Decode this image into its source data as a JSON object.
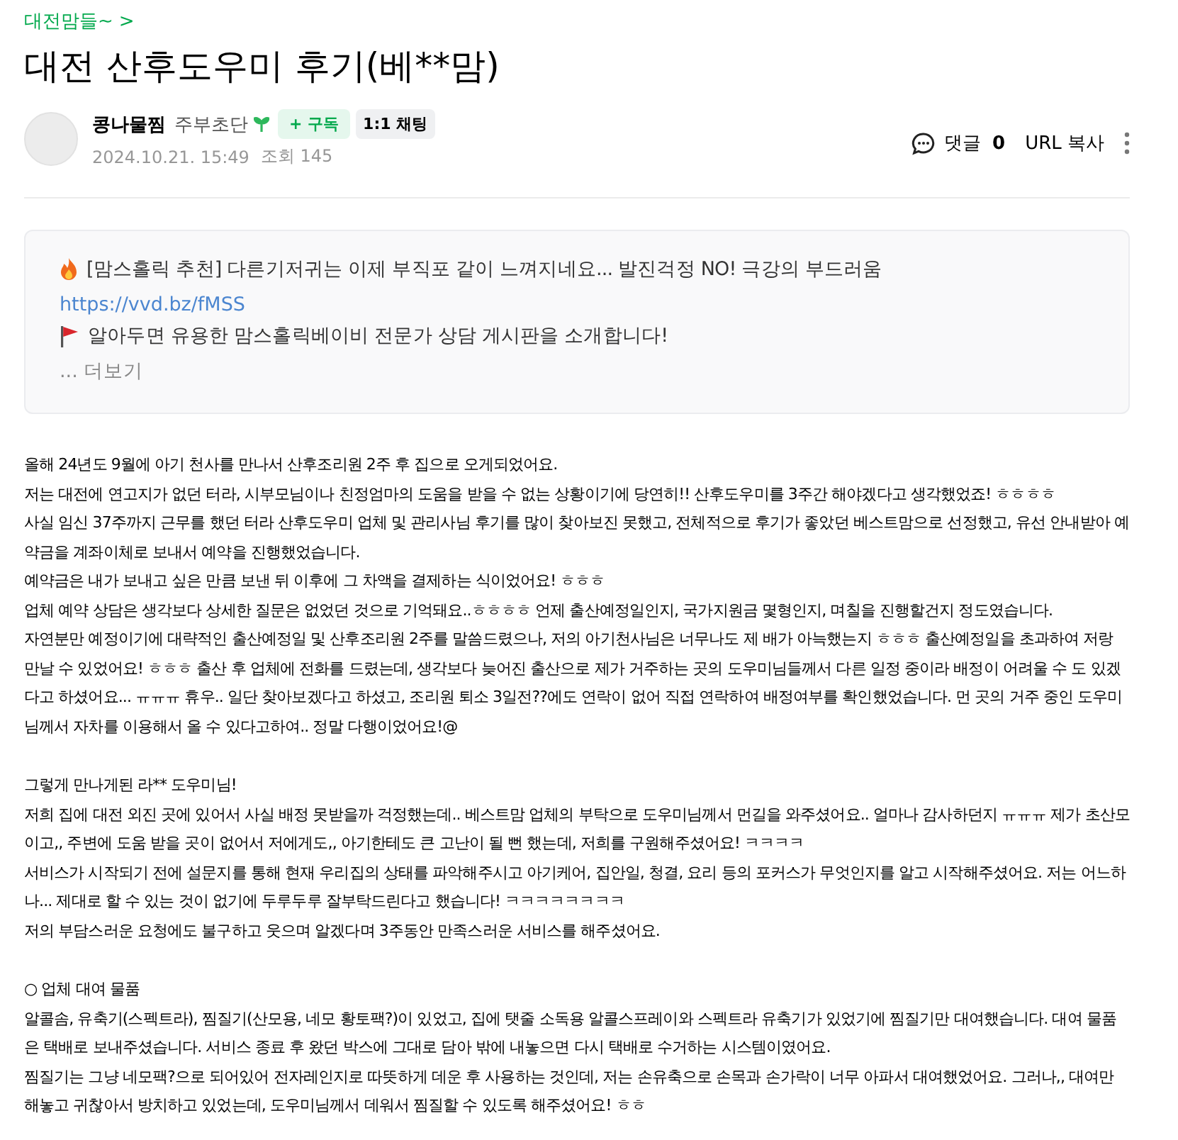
{
  "cafe_link": {
    "label": "대전맘들~",
    "arrow": ">"
  },
  "title": "대전 산후도우미 후기(베**맘)",
  "author": {
    "name": "콩나물찜",
    "grade": "주부초단",
    "subscribe": "+ 구독",
    "chat": "1:1 채팅",
    "date": "2024.10.21. 15:49",
    "views": "조회 145"
  },
  "actions": {
    "comments_label": "댓글",
    "comments_count": "0",
    "url_copy": "URL 복사"
  },
  "notice": {
    "lines": [
      {
        "kind": "fire",
        "text": "[맘스홀릭 추천] 다른기저귀는 이제 부직포 같이 느껴지네요... 발진걱정 NO! 극강의 부드러움"
      },
      {
        "kind": "link",
        "text": "https://vvd.bz/fMSS"
      },
      {
        "kind": "flag",
        "text": "알아두면 유용한 맘스홀릭베이비 전문가 상담 게시판을 소개합니다!"
      }
    ],
    "more": "... 더보기"
  },
  "body": {
    "sections": [
      {
        "paragraphs": [
          "올해 24년도 9월에 아기 천사를 만나서 산후조리원 2주 후 집으로 오게되었어요.",
          "저는 대전에 연고지가 없던 터라, 시부모님이나 친정엄마의 도움을 받을 수 없는 상황이기에 당연히!! 산후도우미를 3주간 해야겠다고 생각했었죠! ㅎㅎㅎㅎ",
          "사실 임신 37주까지 근무를 했던 터라 산후도우미 업체 및 관리사님 후기를 많이 찾아보진 못했고, 전체적으로 후기가 좋았던 베스트맘으로 선정했고, 유선 안내받아 예약금을 계좌이체로 보내서 예약을 진행했었습니다.",
          "예약금은 내가 보내고 싶은 만큼 보낸 뒤 이후에 그 차액을 결제하는 식이었어요! ㅎㅎㅎ",
          "업체 예약 상담은 생각보다 상세한 질문은 없었던 것으로 기억돼요..ㅎㅎㅎㅎ 언제 출산예정일인지, 국가지원금 몇형인지, 며칠을 진행할건지 정도였습니다.",
          "자연분만 예정이기에 대략적인 출산예정일 및 산후조리원 2주를 말씀드렸으나, 저의 아기천사님은 너무나도 제 배가 아늑했는지 ㅎㅎㅎ 출산예정일을 초과하여 저랑 만날 수 있었어요! ㅎㅎㅎ 출산 후 업체에 전화를 드렸는데, 생각보다 늦어진 출산으로 제가 거주하는 곳의 도우미님들께서 다른 일정 중이라 배정이 어려울 수 도 있겠다고 하셨어요... ㅠㅠㅠ 휴우.. 일단 찾아보겠다고 하셨고, 조리원 퇴소 3일전??에도 연락이 없어 직접 연락하여 배정여부를 확인했었습니다. 먼 곳의 거주 중인 도우미님께서 자차를 이용해서 올 수 있다고하여.. 정말 다행이었어요!@"
        ]
      },
      {
        "paragraphs": [
          "그렇게 만나게된 라** 도우미님!",
          "저희 집에 대전 외진 곳에 있어서 사실 배정 못받을까 걱정했는데.. 베스트맘 업체의 부탁으로 도우미님께서 먼길을 와주셨어요.. 얼마나 감사하던지 ㅠㅠㅠ 제가 초산모이고,, 주변에 도움 받을 곳이 없어서 저에게도,, 아기한테도 큰 고난이 될 뻔 했는데, 저희를 구원해주셨어요! ㅋㅋㅋㅋ",
          "서비스가 시작되기 전에 설문지를 통해 현재 우리집의 상태를 파악해주시고 아기케어, 집안일, 청결, 요리 등의 포커스가 무엇인지를 알고 시작해주셨어요. 저는 어느하나... 제대로 할 수 있는 것이 없기에 두루두루 잘부탁드린다고 했습니다! ㅋㅋㅋㅋㅋㅋㅋㅋ",
          "저의 부담스러운 요청에도 불구하고 웃으며 알겠다며 3주동안 만족스러운 서비스를 해주셨어요."
        ]
      },
      {
        "paragraphs": [
          "○ 업체 대여 물품",
          "알콜솜, 유축기(스펙트라), 찜질기(산모용, 네모 황토팩?)이 있었고, 집에 탯줄 소독용 알콜스프레이와 스펙트라 유축기가 있었기에 찜질기만 대여했습니다. 대여 물품은 택배로 보내주셨습니다. 서비스 종료 후 왔던 박스에 그대로 담아 밖에 내놓으면 다시 택배로 수거하는 시스템이였어요.",
          "찜질기는 그냥 네모팩?으로 되어있어 전자레인지로 따뜻하게 데운 후 사용하는 것인데, 저는 손유축으로 손목과 손가락이 너무 아파서 대여했었어요. 그러나,, 대여만 해놓고 귀찮아서 방치하고 있었는데, 도우미님께서 데워서 찜질할 수 있도록 해주셨어요! ㅎㅎ"
        ]
      }
    ]
  }
}
